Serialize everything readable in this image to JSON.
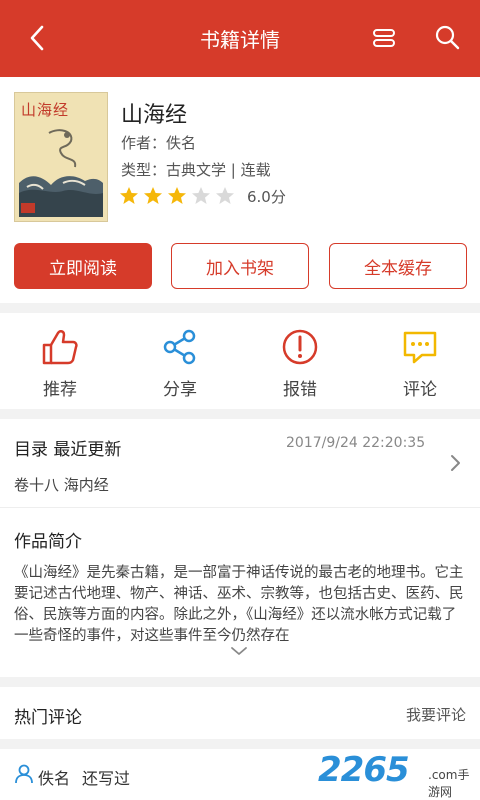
{
  "header": {
    "title": "书籍详情"
  },
  "book": {
    "cover_title": "山海经",
    "title": "山海经",
    "author": "作者：佚名",
    "type": "类型：古典文学 | 连载",
    "rating_stars": 3,
    "rating_max": 5,
    "score": "6.0分"
  },
  "buttons": {
    "read": "立即阅读",
    "shelf": "加入书架",
    "cache": "全本缓存"
  },
  "actions": [
    {
      "label": "推荐",
      "icon": "thumbs-up-icon"
    },
    {
      "label": "分享",
      "icon": "share-icon"
    },
    {
      "label": "报错",
      "icon": "alert-icon"
    },
    {
      "label": "评论",
      "icon": "comment-icon"
    }
  ],
  "toc": {
    "title": "目录  最近更新",
    "time": "2017/9/24 22:20:35",
    "latest": "卷十八 海内经"
  },
  "intro": {
    "title": "作品简介",
    "text": "《山海经》是先秦古籍，是一部富于神话传说的最古老的地理书。它主要记述古代地理、物产、神话、巫术、宗教等，也包括古史、医药、民俗、民族等方面的内容。除此之外，《山海经》还以流水帐方式记载了一些奇怪的事件，对这些事件至今仍然存在"
  },
  "hot_comments": {
    "title": "热门评论",
    "write": "我要评论"
  },
  "comment": {
    "user": "佚名",
    "text": "还写过"
  },
  "watermark": {
    "number": "2265",
    "suffix": ".com",
    "site": "手游网"
  },
  "colors": {
    "accent": "#d63b2a",
    "blue": "#2a8fd8",
    "yellow": "#f2b800",
    "star_on": "#f5b70a",
    "star_off": "#d9d9d9"
  }
}
